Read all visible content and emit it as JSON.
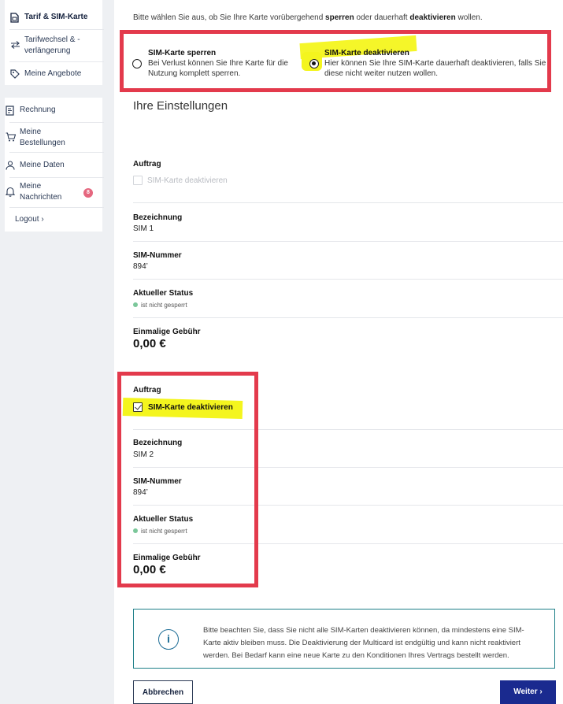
{
  "sidebar": {
    "items_top": [
      {
        "label": "Tarif & SIM-Karte",
        "icon": "sim-card-icon"
      },
      {
        "label": "Tarifwechsel & -\nverlängerung",
        "icon": "swap-arrows-icon"
      },
      {
        "label": "Meine Angebote",
        "icon": "tag-icon"
      }
    ],
    "items_bottom": [
      {
        "label": "Rechnung",
        "icon": "invoice-icon"
      },
      {
        "label": "Meine\nBestellungen",
        "icon": "cart-icon"
      },
      {
        "label": "Meine Daten",
        "icon": "user-icon"
      },
      {
        "label": "Meine\nNachrichten",
        "icon": "bell-icon",
        "badge": "8"
      }
    ],
    "logout_label": "Logout",
    "logout_chevron": "›"
  },
  "main": {
    "intro_prefix": "Bitte wählen Sie aus, ob Sie Ihre Karte vorübergehend ",
    "intro_bold1": "sperren",
    "intro_mid": " oder dauerhaft ",
    "intro_bold2": "deaktivieren",
    "intro_suffix": " wollen.",
    "option_lock": {
      "title": "SIM-Karte sperren",
      "desc": "Bei Verlust können Sie Ihre Karte für die Nutzung komplett sperren.",
      "selected": false
    },
    "option_deactivate": {
      "title": "SIM-Karte deaktivieren",
      "desc": "Hier können Sie Ihre SIM-Karte dauerhaft deaktivieren, falls Sie diese nicht weiter nutzen wollen.",
      "selected": true
    },
    "settings_heading": "Ihre Einstellungen",
    "sim_cards": [
      {
        "order_label": "Auftrag",
        "checkbox_label": "SIM-Karte deaktivieren",
        "checked": false,
        "name_label": "Bezeichnung",
        "name_value": "SIM 1",
        "number_label": "SIM-Nummer",
        "number_value": "894’",
        "status_label": "Aktueller Status",
        "status_value": "ist nicht gesperrt",
        "fee_label": "Einmalige Gebühr",
        "fee_value": "0,00 €"
      },
      {
        "order_label": "Auftrag",
        "checkbox_label": "SIM-Karte deaktivieren",
        "checked": true,
        "name_label": "Bezeichnung",
        "name_value": "SIM 2",
        "number_label": "SIM-Nummer",
        "number_value": "894’",
        "status_label": "Aktueller Status",
        "status_value": "ist nicht gesperrt",
        "fee_label": "Einmalige Gebühr",
        "fee_value": "0,00 €"
      }
    ],
    "info_icon_glyph": "i",
    "info_text": "Bitte beachten Sie, dass Sie nicht alle SIM-Karten deaktivieren können, da mindestens eine SIM-Karte aktiv bleiben muss. Die Deaktivierung der Multicard ist endgültig und kann nicht reaktiviert werden. Bei Bedarf kann eine neue Karte zu den Konditionen Ihres Vertrags bestellt werden.",
    "cancel_label": "Abbrechen",
    "next_label": "Weiter",
    "next_chevron": "›"
  },
  "colors": {
    "annotation_red": "#e33a4c",
    "highlight_yellow": "#f4f51e",
    "primary_button": "#1a2a8f",
    "info_border": "#1d7f88",
    "status_green": "#7bc79a",
    "badge_pink": "#e5677f"
  }
}
